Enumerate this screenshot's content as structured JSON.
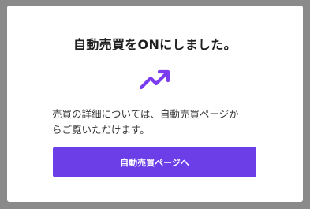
{
  "modal": {
    "title": "自動売買をONにしました。",
    "icon": "trending-up-icon",
    "description_line1": "売買の詳細については、自動売買ページか",
    "description_line2": "らご覧いただけます。",
    "button_label": "自動売買ページへ"
  },
  "colors": {
    "accent": "#6b3ee8",
    "icon": "#7b3cf0",
    "title": "#1f1f1f",
    "text": "#333333",
    "overlay": "#8a8a8a"
  }
}
